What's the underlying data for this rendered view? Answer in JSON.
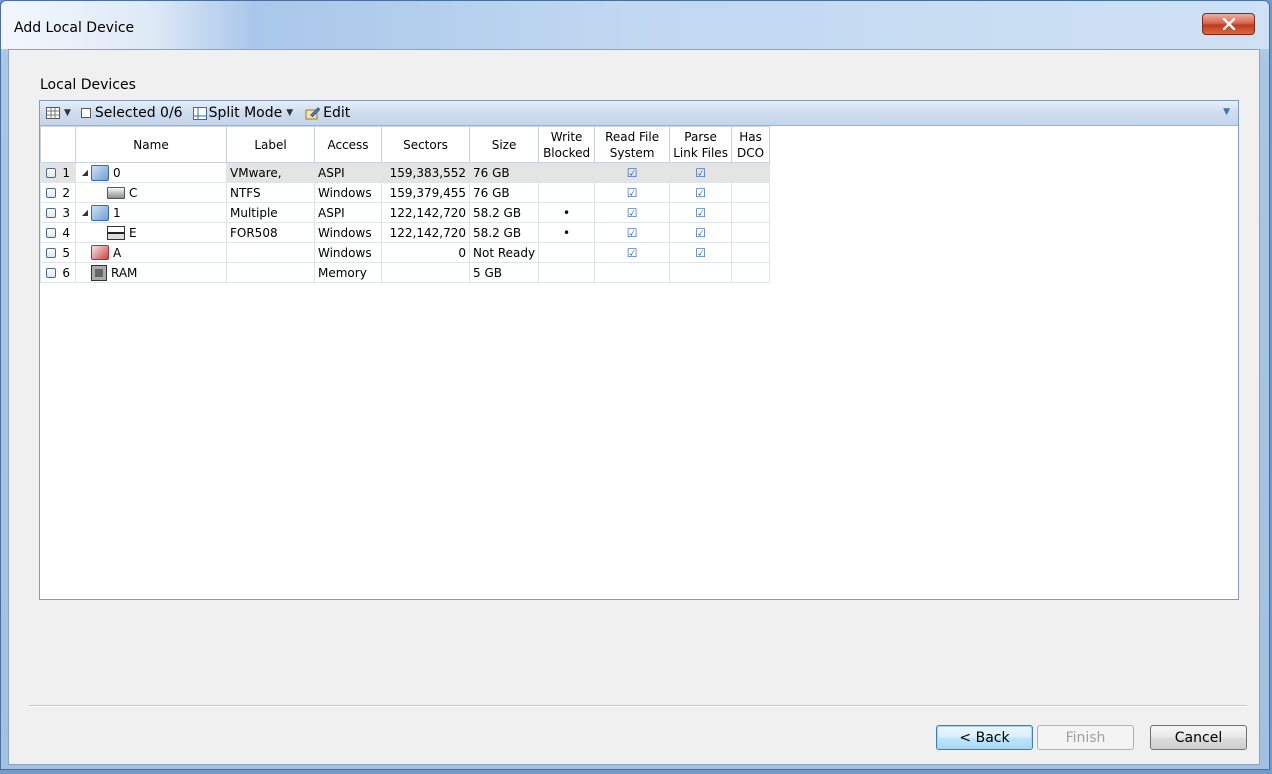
{
  "window": {
    "title": "Add Local Device"
  },
  "section_label": "Local Devices",
  "toolbar": {
    "selected_label": "Selected 0/6",
    "split_mode_label": "Split Mode",
    "edit_label": "Edit"
  },
  "columns": [
    "Name",
    "Label",
    "Access",
    "Sectors",
    "Size",
    "Write Blocked",
    "Read File System",
    "Parse Link Files",
    "Has DCO"
  ],
  "rows": [
    {
      "index": "1",
      "name": "0",
      "label": "VMware,",
      "access": "ASPI",
      "sectors": "159,383,552",
      "size": "76 GB",
      "write_blocked": "",
      "read_fs": "☑",
      "parse_link": "☑",
      "has_dco": ""
    },
    {
      "index": "2",
      "name": "C",
      "label": "NTFS",
      "access": "Windows",
      "sectors": "159,379,455",
      "size": "76 GB",
      "write_blocked": "",
      "read_fs": "☑",
      "parse_link": "☑",
      "has_dco": ""
    },
    {
      "index": "3",
      "name": "1",
      "label": "Multiple",
      "access": "ASPI",
      "sectors": "122,142,720",
      "size": "58.2 GB",
      "write_blocked": "•",
      "read_fs": "☑",
      "parse_link": "☑",
      "has_dco": ""
    },
    {
      "index": "4",
      "name": "E",
      "label": "FOR508",
      "access": "Windows",
      "sectors": "122,142,720",
      "size": "58.2 GB",
      "write_blocked": "•",
      "read_fs": "☑",
      "parse_link": "☑",
      "has_dco": ""
    },
    {
      "index": "5",
      "name": "A",
      "label": "",
      "access": "Windows",
      "sectors": "0",
      "size": "Not Ready",
      "write_blocked": "",
      "read_fs": "☑",
      "parse_link": "☑",
      "has_dco": ""
    },
    {
      "index": "6",
      "name": "RAM",
      "label": "",
      "access": "Memory",
      "sectors": "",
      "size": "5 GB",
      "write_blocked": "",
      "read_fs": "",
      "parse_link": "",
      "has_dco": ""
    }
  ],
  "buttons": {
    "back": "< Back",
    "finish": "Finish",
    "cancel": "Cancel"
  },
  "colors": {
    "titlebar": "#a9c7ea",
    "toolbar": "#cfdcef",
    "close": "#c13a1e",
    "checkmark": "#2f63b3"
  }
}
